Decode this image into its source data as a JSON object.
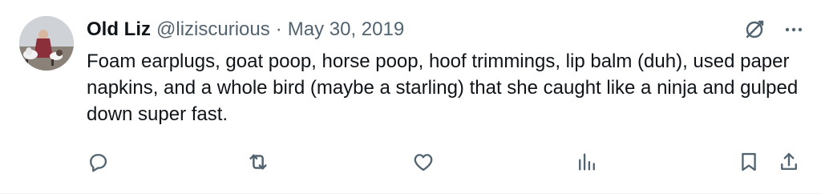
{
  "tweet": {
    "author_name": "Old Liz",
    "author_handle": "@liziscurious",
    "separator": "·",
    "date": "May 30, 2019",
    "text": "Foam earplugs, goat poop, horse poop, hoof trimmings, lip balm (duh), used paper napkins, and a whole bird (maybe a starling) that she caught like a ninja and gulped down super fast."
  },
  "icons": {
    "top": [
      "grok-icon",
      "more-icon"
    ],
    "actions": [
      "reply-icon",
      "retweet-icon",
      "like-icon",
      "views-icon",
      "bookmark-icon",
      "share-icon"
    ]
  },
  "colors": {
    "text": "#0f1419",
    "secondary": "#536471",
    "background": "#ffffff"
  }
}
